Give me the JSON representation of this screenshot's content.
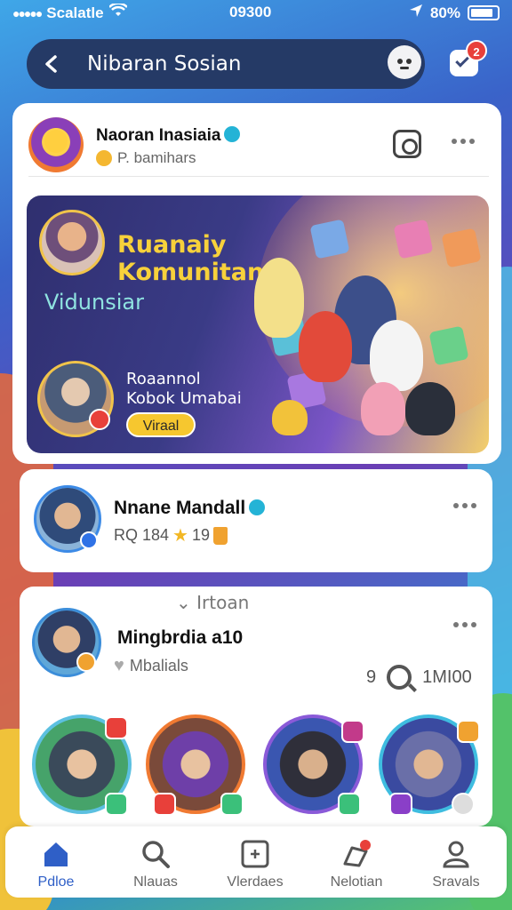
{
  "status_bar": {
    "carrier": "Scalatle",
    "time": "09300",
    "battery": "80%"
  },
  "header": {
    "title": "Nibaran Sosian",
    "notification_count": "2"
  },
  "main_post": {
    "user_name": "Naoran Inasiaia",
    "meta": "P. bamihars",
    "banner": {
      "title_line1": "Ruanaiy",
      "title_line2": "Komunitans",
      "subtitle": "Vidunsiar",
      "small_line1": "Roaannol",
      "small_line2": "Kobok Umabai",
      "button_label": "Viraal"
    }
  },
  "second_post": {
    "user_name": "Nnane Mandall",
    "meta_count": "RQ 184",
    "meta_rating": "19"
  },
  "third_post": {
    "section_label": "⌄ Irtoan",
    "user_name": "Mingbrdia a10",
    "meta": "Mbalials",
    "stat_count": "9",
    "stat_views": "1MI00"
  },
  "bottom_nav": [
    {
      "label": "Pdloe",
      "icon": "home-icon",
      "active": true
    },
    {
      "label": "Nlauas",
      "icon": "search-icon",
      "active": false
    },
    {
      "label": "Vlerdaes",
      "icon": "grid-icon",
      "active": false
    },
    {
      "label": "Nelotian",
      "icon": "notification-icon",
      "active": false
    },
    {
      "label": "Sravals",
      "icon": "profile-icon",
      "active": false
    }
  ],
  "colors": {
    "accent": "#2f5fc7",
    "badge": "#e8403a",
    "banner_text": "#f7d13b",
    "verified": "#24b3d6"
  }
}
